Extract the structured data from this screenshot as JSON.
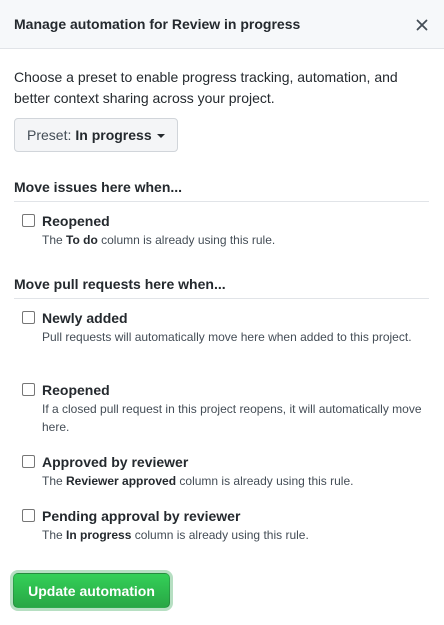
{
  "dialog": {
    "title": "Manage automation for Review in progress",
    "close_icon": "close-icon"
  },
  "intro_text": "Choose a preset to enable progress tracking, automation, and better context sharing across your project.",
  "preset": {
    "prefix": "Preset:",
    "value": "In progress"
  },
  "issues_section": {
    "title": "Move issues here when...",
    "rules": [
      {
        "label": "Reopened",
        "checked": false,
        "desc_pre": "The ",
        "desc_bold": "To do",
        "desc_post": " column is already using this rule."
      }
    ]
  },
  "pr_section": {
    "title": "Move pull requests here when...",
    "rules": [
      {
        "label": "Newly added",
        "checked": false,
        "desc": "Pull requests will automatically move here when added to this project."
      },
      {
        "label": "Reopened",
        "checked": false,
        "desc": "If a closed pull request in this project reopens, it will automatically move here."
      },
      {
        "label": "Approved by reviewer",
        "checked": false,
        "desc_pre": "The ",
        "desc_bold": "Reviewer approved",
        "desc_post": " column is already using this rule."
      },
      {
        "label": "Pending approval by reviewer",
        "checked": false,
        "desc_pre": "The ",
        "desc_bold": "In progress",
        "desc_post": " column is already using this rule."
      }
    ]
  },
  "update_button_label": "Update automation",
  "colors": {
    "primary_button": "#2ea44f",
    "header_background": "#f6f8fa",
    "border": "#e1e4e8"
  }
}
